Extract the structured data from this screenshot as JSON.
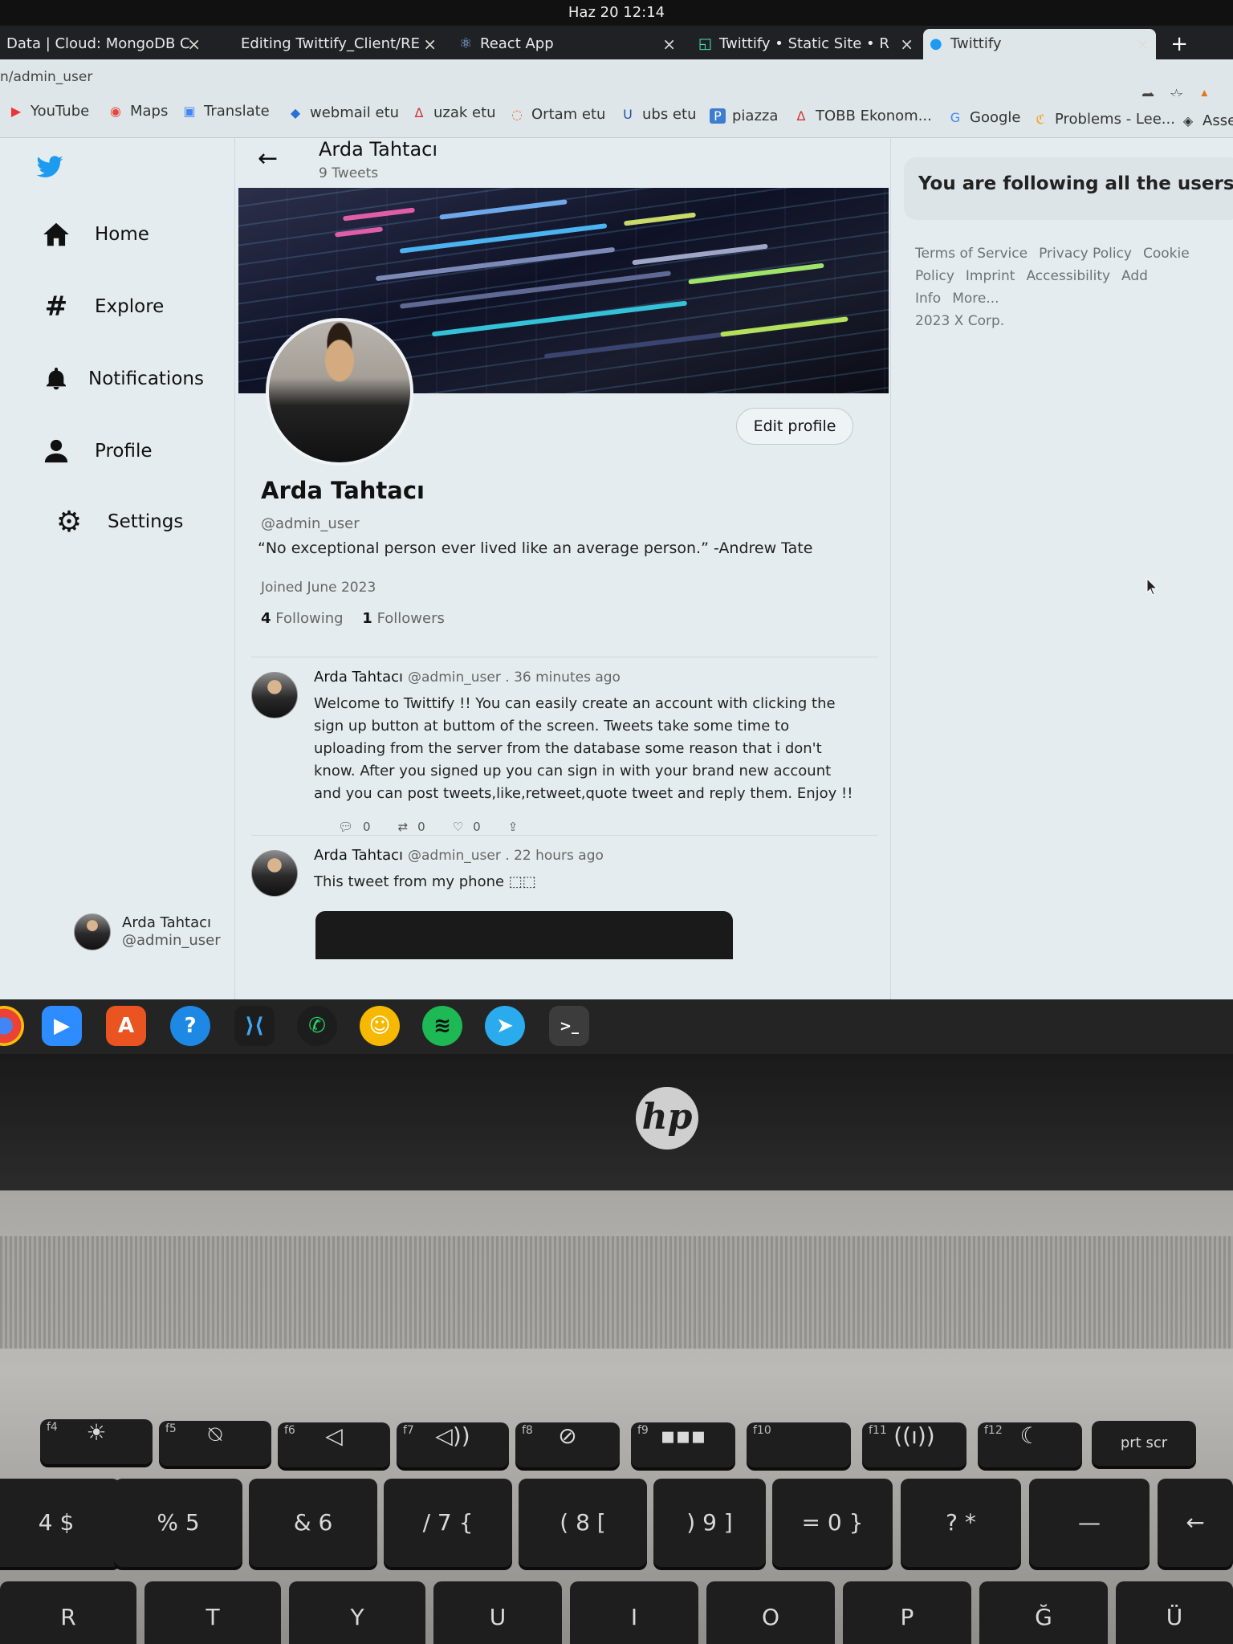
{
  "system": {
    "clock": "Haz 20  12:14"
  },
  "tabs": [
    {
      "label": "Data | Cloud: MongoDB C",
      "close": "×"
    },
    {
      "label": "Editing Twittify_Client/RE",
      "close": "×"
    },
    {
      "label": "React App",
      "close": "×"
    },
    {
      "label": "Twittify • Static Site • R",
      "close": "×"
    },
    {
      "label": "Twittify",
      "close": "×",
      "active": true
    }
  ],
  "new_tab": "+",
  "address": {
    "url": "n/admin_user"
  },
  "bookmarks": [
    "YouTube",
    "Maps",
    "Translate",
    "webmail etu",
    "uzak etu",
    "Ortam etu",
    "ubs etu",
    "piazza",
    "TOBB Ekonom...",
    "Google",
    "Problems - Lee...",
    "Asse"
  ],
  "nav": {
    "home": "Home",
    "explore": "Explore",
    "notifications": "Notifications",
    "profile": "Profile",
    "settings": "Settings"
  },
  "account": {
    "name": "Arda Tahtacı",
    "handle": "@admin_user"
  },
  "profile": {
    "header_name": "Arda Tahtacı",
    "tweet_count": "9 Tweets",
    "edit_button": "Edit profile",
    "name": "Arda Tahtacı",
    "handle": "@admin_user",
    "bio": "“No exceptional person ever lived like an average person.” -Andrew Tate",
    "joined": "Joined June 2023",
    "following_count": "4",
    "following_label": "Following",
    "followers_count": "1",
    "followers_label": "Followers"
  },
  "tweets": [
    {
      "author": "Arda Tahtacı",
      "meta": "@admin_user . 36 minutes ago",
      "text": "Welcome to Twittify !! You can easily create an account with clicking the sign up button at buttom of the screen. Tweets take some time to uploading from the server from the database some reason that i don't know. After you signed up you can sign in with your brand new account and you can post tweets,like,retweet,quote tweet and reply them. Enjoy !!",
      "replies": "0",
      "retweets": "0",
      "likes": "0"
    },
    {
      "author": "Arda Tahtacı",
      "meta": "@admin_user . 22 hours ago",
      "text": "This tweet from my phone ⬚⬚"
    }
  ],
  "sidebar": {
    "follow_box": "You are following all the users",
    "footer": [
      "Terms of Service",
      "Privacy Policy",
      "Cookie Policy",
      "Imprint",
      "Accessibility",
      "Add Info",
      "More...",
      "2023 X Corp."
    ]
  },
  "laptop": {
    "brand": "hp",
    "keys_fn": [
      "f4",
      "f5",
      "f6",
      "f7",
      "f8",
      "f9",
      "f10",
      "f11",
      "f12",
      "prt scr"
    ],
    "keys_num": [
      "4 $",
      "% 5",
      "& 6",
      "/ 7 {",
      "( 8 [",
      ") 9 ]",
      "= 0 }",
      "? *",
      "—"
    ],
    "keys_letters": [
      "R",
      "T",
      "Y",
      "U",
      "I",
      "O",
      "P",
      "Ğ",
      "Ü"
    ]
  }
}
